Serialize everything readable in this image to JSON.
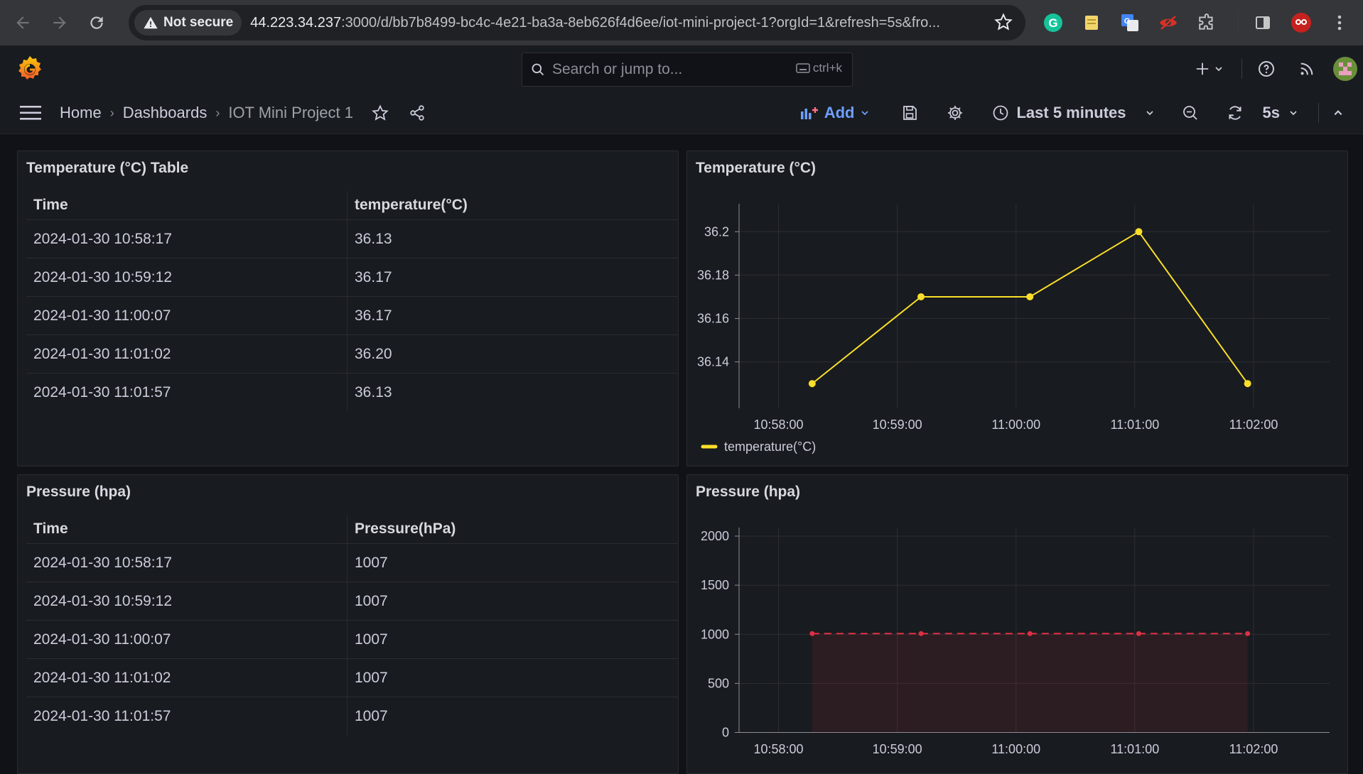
{
  "browser": {
    "security_label": "Not secure",
    "url_host": "44.223.34.237",
    "url_rest": ":3000/d/bb7b8499-bc4c-4e21-ba3a-8eb626f4d6ee/iot-mini-project-1?orgId=1&refresh=5s&fro..."
  },
  "topbar": {
    "search_placeholder": "Search or jump to...",
    "shortcut": "ctrl+k"
  },
  "breadcrumb": {
    "home": "Home",
    "dashboards": "Dashboards",
    "current": "IOT Mini Project 1"
  },
  "toolbar": {
    "add_label": "Add",
    "time_range": "Last 5 minutes",
    "refresh_interval": "5s",
    "accent": "#6e9fff"
  },
  "panels": {
    "temp_table": {
      "title": "Temperature (°C) Table",
      "columns": [
        "Time",
        "temperature(°C)"
      ],
      "rows": [
        [
          "2024-01-30 10:58:17",
          "36.13"
        ],
        [
          "2024-01-30 10:59:12",
          "36.17"
        ],
        [
          "2024-01-30 11:00:07",
          "36.17"
        ],
        [
          "2024-01-30 11:01:02",
          "36.20"
        ],
        [
          "2024-01-30 11:01:57",
          "36.13"
        ]
      ]
    },
    "pressure_table": {
      "title": "Pressure (hpa)",
      "columns": [
        "Time",
        "Pressure(hPa)"
      ],
      "rows": [
        [
          "2024-01-30 10:58:17",
          "1007"
        ],
        [
          "2024-01-30 10:59:12",
          "1007"
        ],
        [
          "2024-01-30 11:00:07",
          "1007"
        ],
        [
          "2024-01-30 11:01:02",
          "1007"
        ],
        [
          "2024-01-30 11:01:57",
          "1007"
        ]
      ]
    },
    "temp_chart": {
      "title": "Temperature (°C)"
    },
    "pressure_chart": {
      "title": "Pressure (hpa)"
    }
  },
  "chart_data": [
    {
      "type": "line",
      "title": "Temperature (°C)",
      "x": [
        "10:58:17",
        "10:59:12",
        "11:00:07",
        "11:01:02",
        "11:01:57"
      ],
      "series": [
        {
          "name": "temperature(°C)",
          "values": [
            36.13,
            36.17,
            36.17,
            36.2,
            36.13
          ],
          "color": "#fade2a"
        }
      ],
      "x_ticks": [
        "10:58:00",
        "10:59:00",
        "11:00:00",
        "11:01:00",
        "11:02:00"
      ],
      "y_ticks": [
        "36.14",
        "36.16",
        "36.18",
        "36.2"
      ],
      "ylim": [
        36.125,
        36.205
      ],
      "legend": "bottom-left",
      "grid": true
    },
    {
      "type": "area",
      "title": "Pressure (hpa)",
      "x": [
        "10:58:17",
        "10:59:12",
        "11:00:07",
        "11:01:02",
        "11:01:57"
      ],
      "series": [
        {
          "values": [
            1007,
            1007,
            1007,
            1007,
            1007
          ],
          "color": "#e02f44"
        }
      ],
      "x_ticks": [
        "10:58:00",
        "10:59:00",
        "11:00:00",
        "11:01:00",
        "11:02:00"
      ],
      "y_ticks": [
        "0",
        "500",
        "1000",
        "1500",
        "2000"
      ],
      "ylim": [
        0,
        2000
      ],
      "grid": true
    }
  ]
}
